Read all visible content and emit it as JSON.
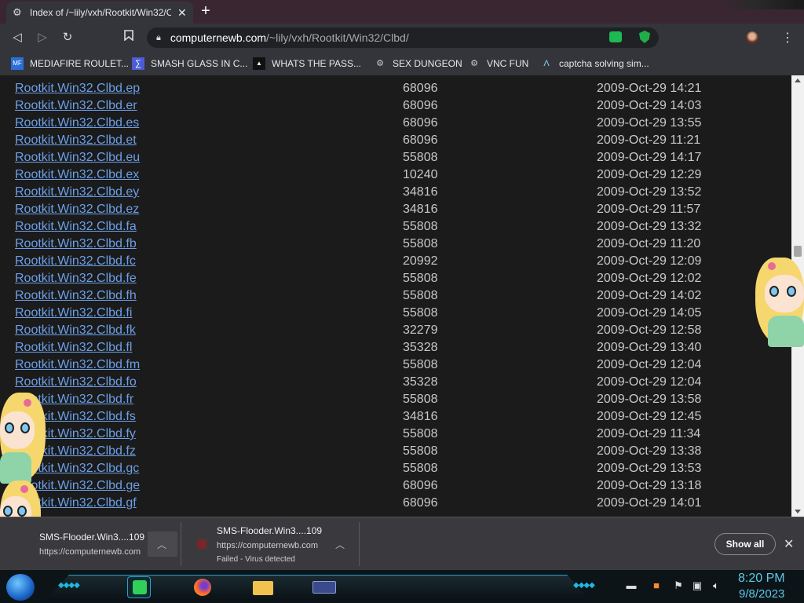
{
  "tab": {
    "title": "Index of /~lily/vxh/Rootkit/Win32/Clbd/",
    "close": "✕",
    "new_tab": "+"
  },
  "nav": {
    "back": "◁",
    "forward": "▷",
    "reload": "↻",
    "bookmark_icon": "bookmark-icon",
    "url_host": "computernewb.com",
    "url_path": "/~lily/vxh/Rootkit/Win32/Clbd/",
    "menu": "⋮"
  },
  "bookmarks": [
    {
      "label": "MEDIAFIRE ROULET...",
      "icon": "MF",
      "color": "#2a6fd6"
    },
    {
      "label": "SMASH GLASS IN C...",
      "icon": "∑",
      "color": "#4b5cd6"
    },
    {
      "label": "WHATS THE PASS...",
      "icon": "▲",
      "color": "#222222"
    },
    {
      "label": "SEX DUNGEON",
      "icon": "⚙",
      "color": "#cccccc"
    },
    {
      "label": "VNC FUN",
      "icon": "⚙",
      "color": "#cccccc"
    },
    {
      "label": "captcha solving sim...",
      "icon": "Λ",
      "color": "#7fd3f0"
    }
  ],
  "files": [
    {
      "name": "Rootkit.Win32.Clbd.ep",
      "size": "68096",
      "date": "2009-Oct-29 14:21"
    },
    {
      "name": "Rootkit.Win32.Clbd.er",
      "size": "68096",
      "date": "2009-Oct-29 14:03"
    },
    {
      "name": "Rootkit.Win32.Clbd.es",
      "size": "68096",
      "date": "2009-Oct-29 13:55"
    },
    {
      "name": "Rootkit.Win32.Clbd.et",
      "size": "68096",
      "date": "2009-Oct-29 11:21"
    },
    {
      "name": "Rootkit.Win32.Clbd.eu",
      "size": "55808",
      "date": "2009-Oct-29 14:17"
    },
    {
      "name": "Rootkit.Win32.Clbd.ex",
      "size": "10240",
      "date": "2009-Oct-29 12:29"
    },
    {
      "name": "Rootkit.Win32.Clbd.ey",
      "size": "34816",
      "date": "2009-Oct-29 13:52"
    },
    {
      "name": "Rootkit.Win32.Clbd.ez",
      "size": "34816",
      "date": "2009-Oct-29 11:57"
    },
    {
      "name": "Rootkit.Win32.Clbd.fa",
      "size": "55808",
      "date": "2009-Oct-29 13:32"
    },
    {
      "name": "Rootkit.Win32.Clbd.fb",
      "size": "55808",
      "date": "2009-Oct-29 11:20"
    },
    {
      "name": "Rootkit.Win32.Clbd.fc",
      "size": "20992",
      "date": "2009-Oct-29 12:09"
    },
    {
      "name": "Rootkit.Win32.Clbd.fe",
      "size": "55808",
      "date": "2009-Oct-29 12:02"
    },
    {
      "name": "Rootkit.Win32.Clbd.fh",
      "size": "55808",
      "date": "2009-Oct-29 14:02"
    },
    {
      "name": "Rootkit.Win32.Clbd.fi",
      "size": "55808",
      "date": "2009-Oct-29 14:05"
    },
    {
      "name": "Rootkit.Win32.Clbd.fk",
      "size": "32279",
      "date": "2009-Oct-29 12:58"
    },
    {
      "name": "Rootkit.Win32.Clbd.fl",
      "size": "35328",
      "date": "2009-Oct-29 13:40"
    },
    {
      "name": "Rootkit.Win32.Clbd.fm",
      "size": "55808",
      "date": "2009-Oct-29 12:04"
    },
    {
      "name": "Rootkit.Win32.Clbd.fo",
      "size": "35328",
      "date": "2009-Oct-29 12:04"
    },
    {
      "name": "Rootkit.Win32.Clbd.fr",
      "size": "55808",
      "date": "2009-Oct-29 13:58"
    },
    {
      "name": "Rootkit.Win32.Clbd.fs",
      "size": "34816",
      "date": "2009-Oct-29 12:45"
    },
    {
      "name": "Rootkit.Win32.Clbd.fy",
      "size": "55808",
      "date": "2009-Oct-29 11:34"
    },
    {
      "name": "Rootkit.Win32.Clbd.fz",
      "size": "55808",
      "date": "2009-Oct-29 13:38"
    },
    {
      "name": "Rootkit.Win32.Clbd.gc",
      "size": "55808",
      "date": "2009-Oct-29 13:53"
    },
    {
      "name": "Rootkit.Win32.Clbd.ge",
      "size": "68096",
      "date": "2009-Oct-29 13:18"
    },
    {
      "name": "Rootkit.Win32.Clbd.gf",
      "size": "68096",
      "date": "2009-Oct-29 14:01"
    }
  ],
  "downloads": {
    "items": [
      {
        "file": "SMS-Flooder.Win3....109",
        "source": "https://computernewb.com",
        "status": ""
      },
      {
        "file": "SMS-Flooder.Win3....109",
        "source": "https://computernewb.com",
        "status": "Failed - Virus detected"
      }
    ],
    "show_all": "Show all",
    "close": "✕"
  },
  "taskbar": {
    "time": "8:20 PM",
    "date": "9/8/2023",
    "accent": "#5ec8e8"
  },
  "colors": {
    "link": "#6b9fe7",
    "page_bg": "#1b1b1b",
    "chrome_bg": "#34353a"
  }
}
